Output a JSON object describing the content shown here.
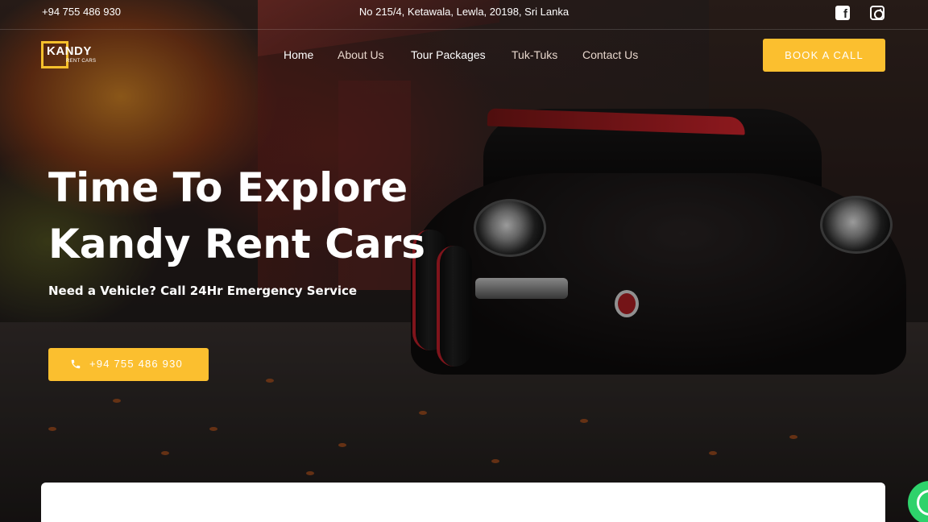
{
  "topbar": {
    "phone": "+94 755 486 930",
    "address": "No 215/4, Ketawala, Lewla, 20198, Sri Lanka",
    "social": [
      {
        "icon": "facebook-icon"
      },
      {
        "icon": "instagram-icon"
      }
    ]
  },
  "brand": {
    "name": "KANDY",
    "tagline": "RENT CARS",
    "accent_color": "#fbbf2f"
  },
  "nav": {
    "items": [
      {
        "label": "Home"
      },
      {
        "label": "About Us"
      },
      {
        "label": "Tour Packages"
      },
      {
        "label": "Tuk-Tuks"
      },
      {
        "label": "Contact Us"
      }
    ],
    "cta_label": "BOOK A CALL"
  },
  "hero": {
    "title_line1": "Time To Explore",
    "title_line2": "Kandy Rent Cars",
    "subtitle": "Need a Vehicle? Call 24Hr Emergency Service",
    "call_button_label": "+94 755 486 930",
    "call_button_icon": "phone-icon"
  },
  "floating": {
    "whatsapp_icon": "whatsapp-icon",
    "whatsapp_color": "#2ed26b"
  }
}
